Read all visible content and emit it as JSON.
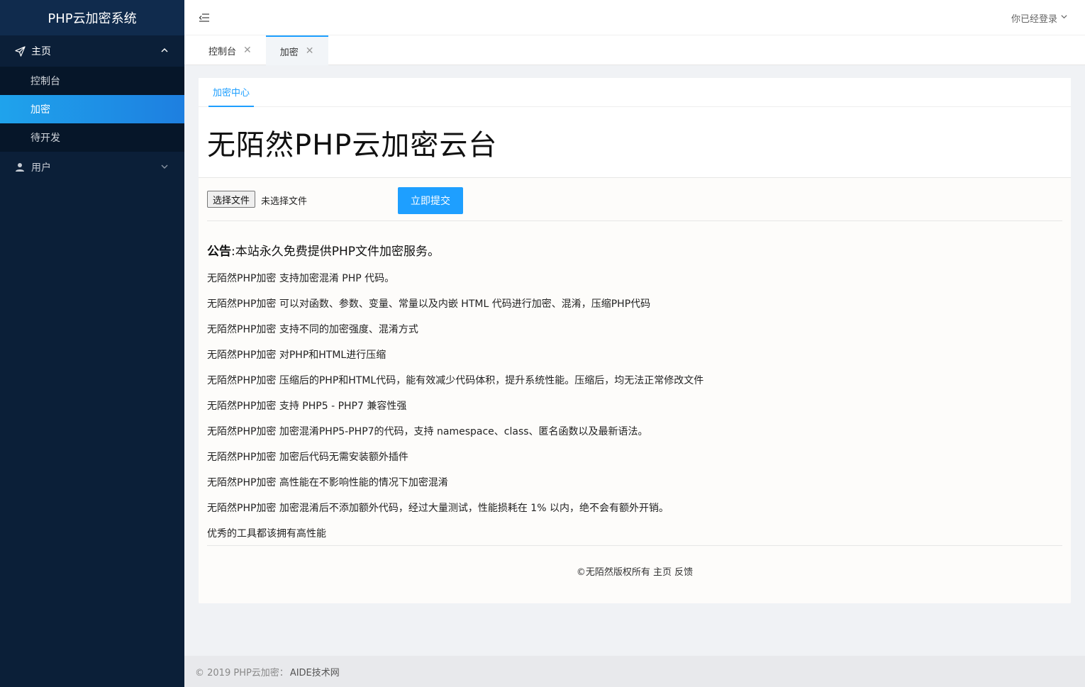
{
  "app": {
    "title": "PHP云加密系统"
  },
  "sidebar": {
    "groups": [
      {
        "label": "主页",
        "icon": "paper-plane-icon",
        "expanded": true,
        "items": [
          {
            "label": "控制台",
            "active": false
          },
          {
            "label": "加密",
            "active": true
          },
          {
            "label": "待开发",
            "active": false
          }
        ]
      },
      {
        "label": "用户",
        "icon": "user-icon",
        "expanded": false
      }
    ]
  },
  "header": {
    "user_label": "你已经登录"
  },
  "tabs": [
    {
      "label": "控制台",
      "active": false
    },
    {
      "label": "加密",
      "active": true
    }
  ],
  "card": {
    "tab_label": "加密中心",
    "hero_title": "无陌然PHP云加密云台",
    "file_button": "选择文件",
    "file_status": "未选择文件",
    "submit_label": "立即提交",
    "notice_bold": "公告",
    "notice_text": ":本站永久免费提供PHP文件加密服务。",
    "lines": [
      "无陌然PHP加密 支持加密混淆 PHP 代码。",
      "无陌然PHP加密 可以对函数、参数、变量、常量以及内嵌 HTML 代码进行加密、混淆，压缩PHP代码",
      "无陌然PHP加密 支持不同的加密强度、混淆方式",
      "无陌然PHP加密 对PHP和HTML进行压缩",
      "无陌然PHP加密 压缩后的PHP和HTML代码，能有效减少代码体积，提升系统性能。压缩后，均无法正常修改文件",
      "无陌然PHP加密 支持 PHP5 - PHP7 兼容性强",
      "无陌然PHP加密 加密混淆PHP5-PHP7的代码，支持 namespace、class、匿名函数以及最新语法。",
      "无陌然PHP加密 加密后代码无需安装额外插件",
      "无陌然PHP加密 高性能在不影响性能的情况下加密混淆",
      "无陌然PHP加密 加密混淆后不添加额外代码，经过大量测试，性能损耗在 1% 以内，绝不会有额外开销。",
      "优秀的工具都该拥有高性能"
    ],
    "footer": {
      "copyright": "©无陌然版权所有",
      "home": "主页",
      "feedback": "反馈"
    }
  },
  "page_footer": {
    "text": "© 2019 PHP云加密：",
    "brand": "AIDE技术网"
  },
  "colors": {
    "sidebar_bg": "#0b1f38",
    "accent": "#1e9fff",
    "active_item": "#1e8fe6"
  }
}
